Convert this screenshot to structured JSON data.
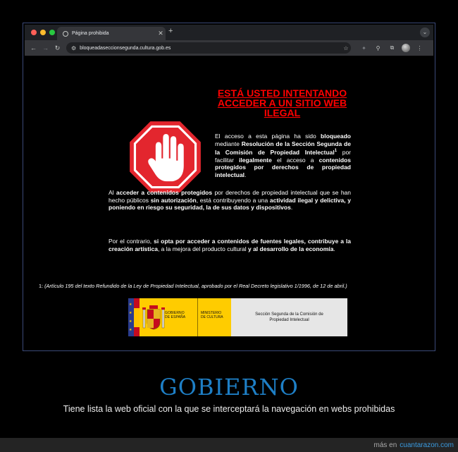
{
  "browser": {
    "tab_title": "Página prohibida",
    "tab_close": "✕",
    "new_tab": "+",
    "tab_menu": "⌄",
    "back": "←",
    "forward": "→",
    "reload": "↻",
    "url": "bloqueadaseccionsegunda.cultura.gob.es"
  },
  "page": {
    "heading": "ESTÁ USTED INTENTANDO ACCEDER A UN SITIO WEB ILEGAL",
    "p1": {
      "t1": "El acceso a esta página ha sido ",
      "b1": "bloqueado",
      "t2": " mediante ",
      "b2": "Resolución de la Sección Segunda de la Comisión de Propiedad Intelectual",
      "sup": "1",
      "t3": " por facilitar ",
      "b3": "ilegalmente",
      "t4": " el acceso a ",
      "b4": "contenidos protegidos por derechos de propiedad intelectual",
      "t5": "."
    },
    "p2": {
      "t1": "Al ",
      "b1": "acceder a contenidos protegidos",
      "t2": " por derechos de propiedad intelectual que se han hecho públicos ",
      "b2": "sin autorización",
      "t3": ", está contribuyendo a una ",
      "b3": "actividad ilegal y delictiva, y poniendo en riesgo su seguridad, la de sus datos y dispositivos",
      "t4": "."
    },
    "p3": {
      "t1": "Por el contrario, ",
      "b1": "si opta por acceder a contenidos de fuentes legales, contribuye a la creación artística",
      "t2": ", a la mejora del producto cultural ",
      "b2": "y al desarrollo de la economía",
      "t3": "."
    },
    "footnote_num": "1:",
    "footnote_text": "(Artículo 195 del texto Refundido de la Ley de Propiedad Intelectual, aprobado por el Real Decreto legislativo 1/1996, de 12 de abril.)",
    "banner": {
      "gov_line1": "GOBIERNO",
      "gov_line2": "DE ESPAÑA",
      "min_line1": "MINISTERIO",
      "min_line2": "DE CULTURA",
      "section_line1": "Sección Segunda de la Comisión de",
      "section_line2": "Propiedad Intelectual"
    }
  },
  "caption": {
    "title": "GOBIERNO",
    "subtitle": "Tiene lista la web oficial con la que se interceptará la navegación en webs prohibidas"
  },
  "credit": {
    "prefix": "más en",
    "site": "cuantarazon.com"
  },
  "colors": {
    "heading_red": "#ff0000",
    "stop_red": "#e3262e",
    "caption_blue": "#1e7fc6",
    "banner_yellow": "#ffcc00"
  }
}
